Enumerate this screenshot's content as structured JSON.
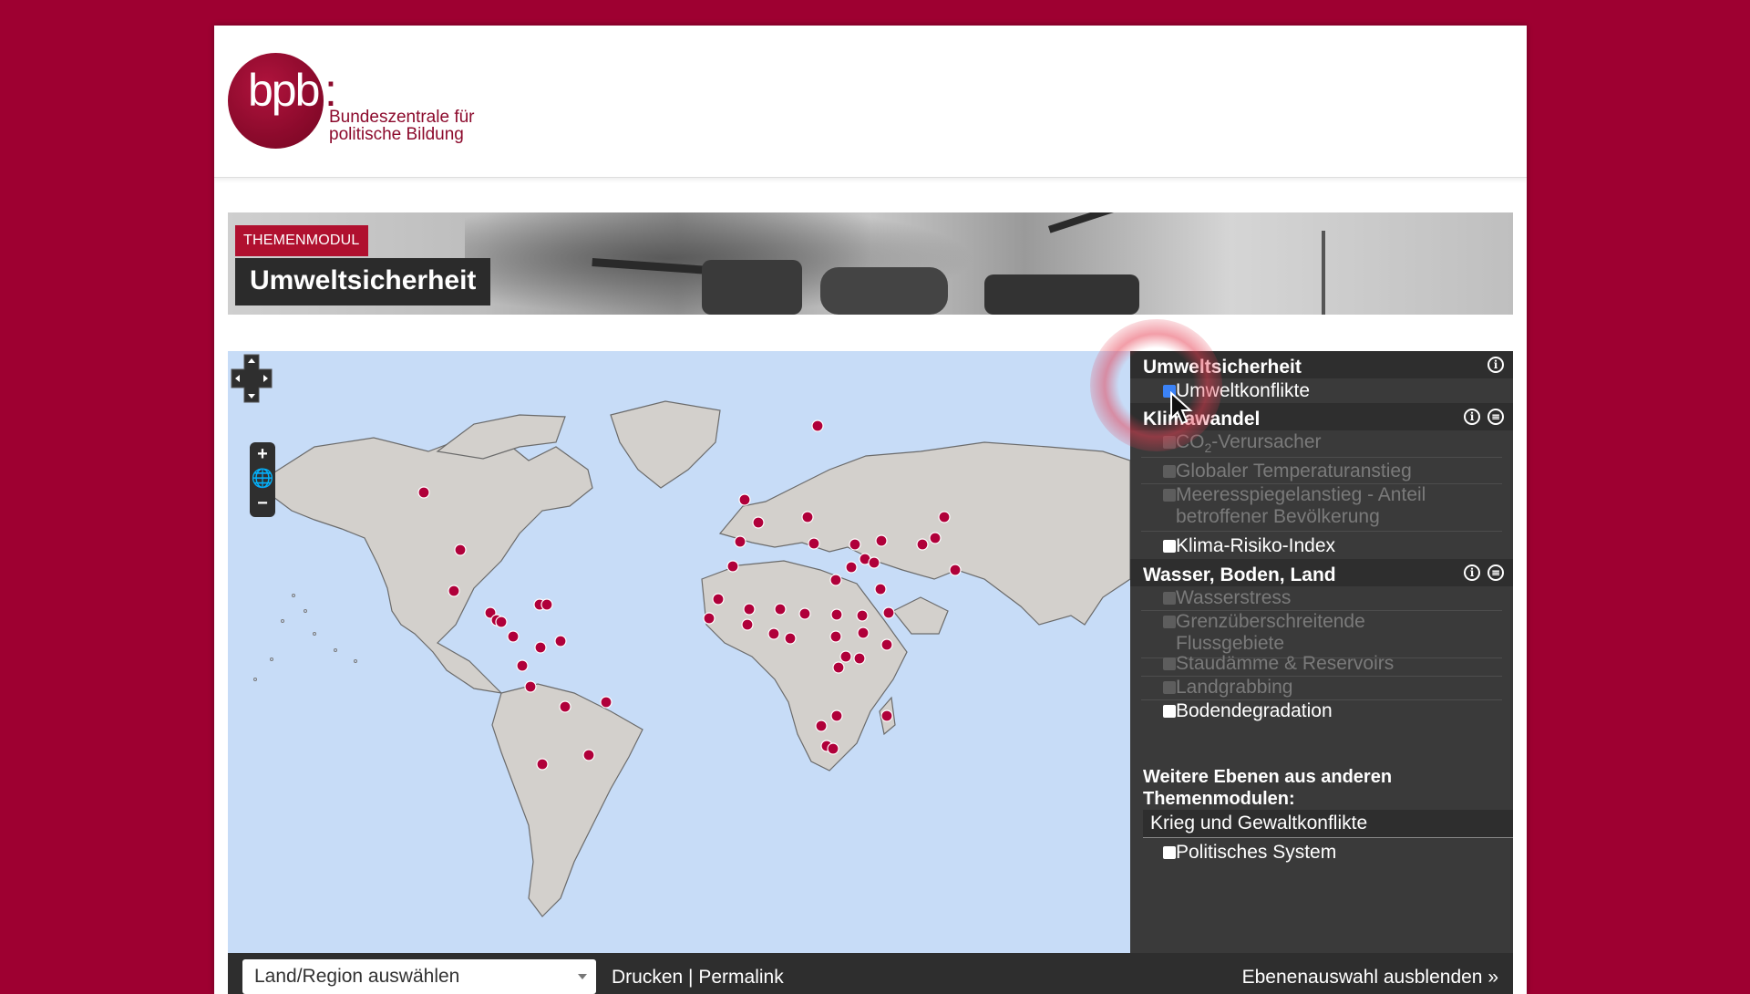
{
  "logo": {
    "wordmark": "bpb",
    "colon": ":",
    "line1": "Bundeszentrale für",
    "line2": "politische Bildung"
  },
  "banner": {
    "tag": "THEMENMODUL",
    "title": "Umweltsicherheit"
  },
  "map": {
    "zoom_in": "+",
    "zoom_out": "−"
  },
  "panel": {
    "sections": [
      {
        "title": "Umweltsicherheit",
        "items": [
          {
            "label": "Umweltkonflikte",
            "checked": true,
            "enabled": true
          }
        ]
      },
      {
        "title": "Klimawandel",
        "items": [
          {
            "label": "CO",
            "sub": "2",
            "suffix": "-Verursacher",
            "enabled": false
          },
          {
            "label": "Globaler Temperaturanstieg",
            "enabled": false
          },
          {
            "label": "Meeresspiegelanstieg - Anteil",
            "label2": "betroffener Bevölkerung",
            "enabled": false
          },
          {
            "label": "Klima-Risiko-Index",
            "enabled": true
          }
        ]
      },
      {
        "title": "Wasser, Boden, Land",
        "items": [
          {
            "label": "Wasserstress",
            "enabled": false
          },
          {
            "label": "Grenzüberschreitende",
            "label2": "Flussgebiete",
            "enabled": false
          },
          {
            "label": "Staudämme & Reservoirs",
            "enabled": false
          },
          {
            "label": "Landgrabbing",
            "enabled": false
          },
          {
            "label": "Bodendegradation",
            "enabled": true
          }
        ]
      }
    ],
    "more_heading_1": "Weitere Ebenen aus anderen",
    "more_heading_2": "Themenmodulen:",
    "more_group": "Krieg und Gewaltkonflikte",
    "more_item": "Politisches System"
  },
  "bottom": {
    "select_value": "Land/Region auswählen",
    "print": "Drucken",
    "divider": "|",
    "permalink": "Permalink",
    "toggle": "Ebenenauswahl ausblenden »"
  },
  "colors": {
    "accent": "#9e0031",
    "marker": "#b0003a",
    "land": "#d3d0cc",
    "water": "#c7dcf7"
  }
}
